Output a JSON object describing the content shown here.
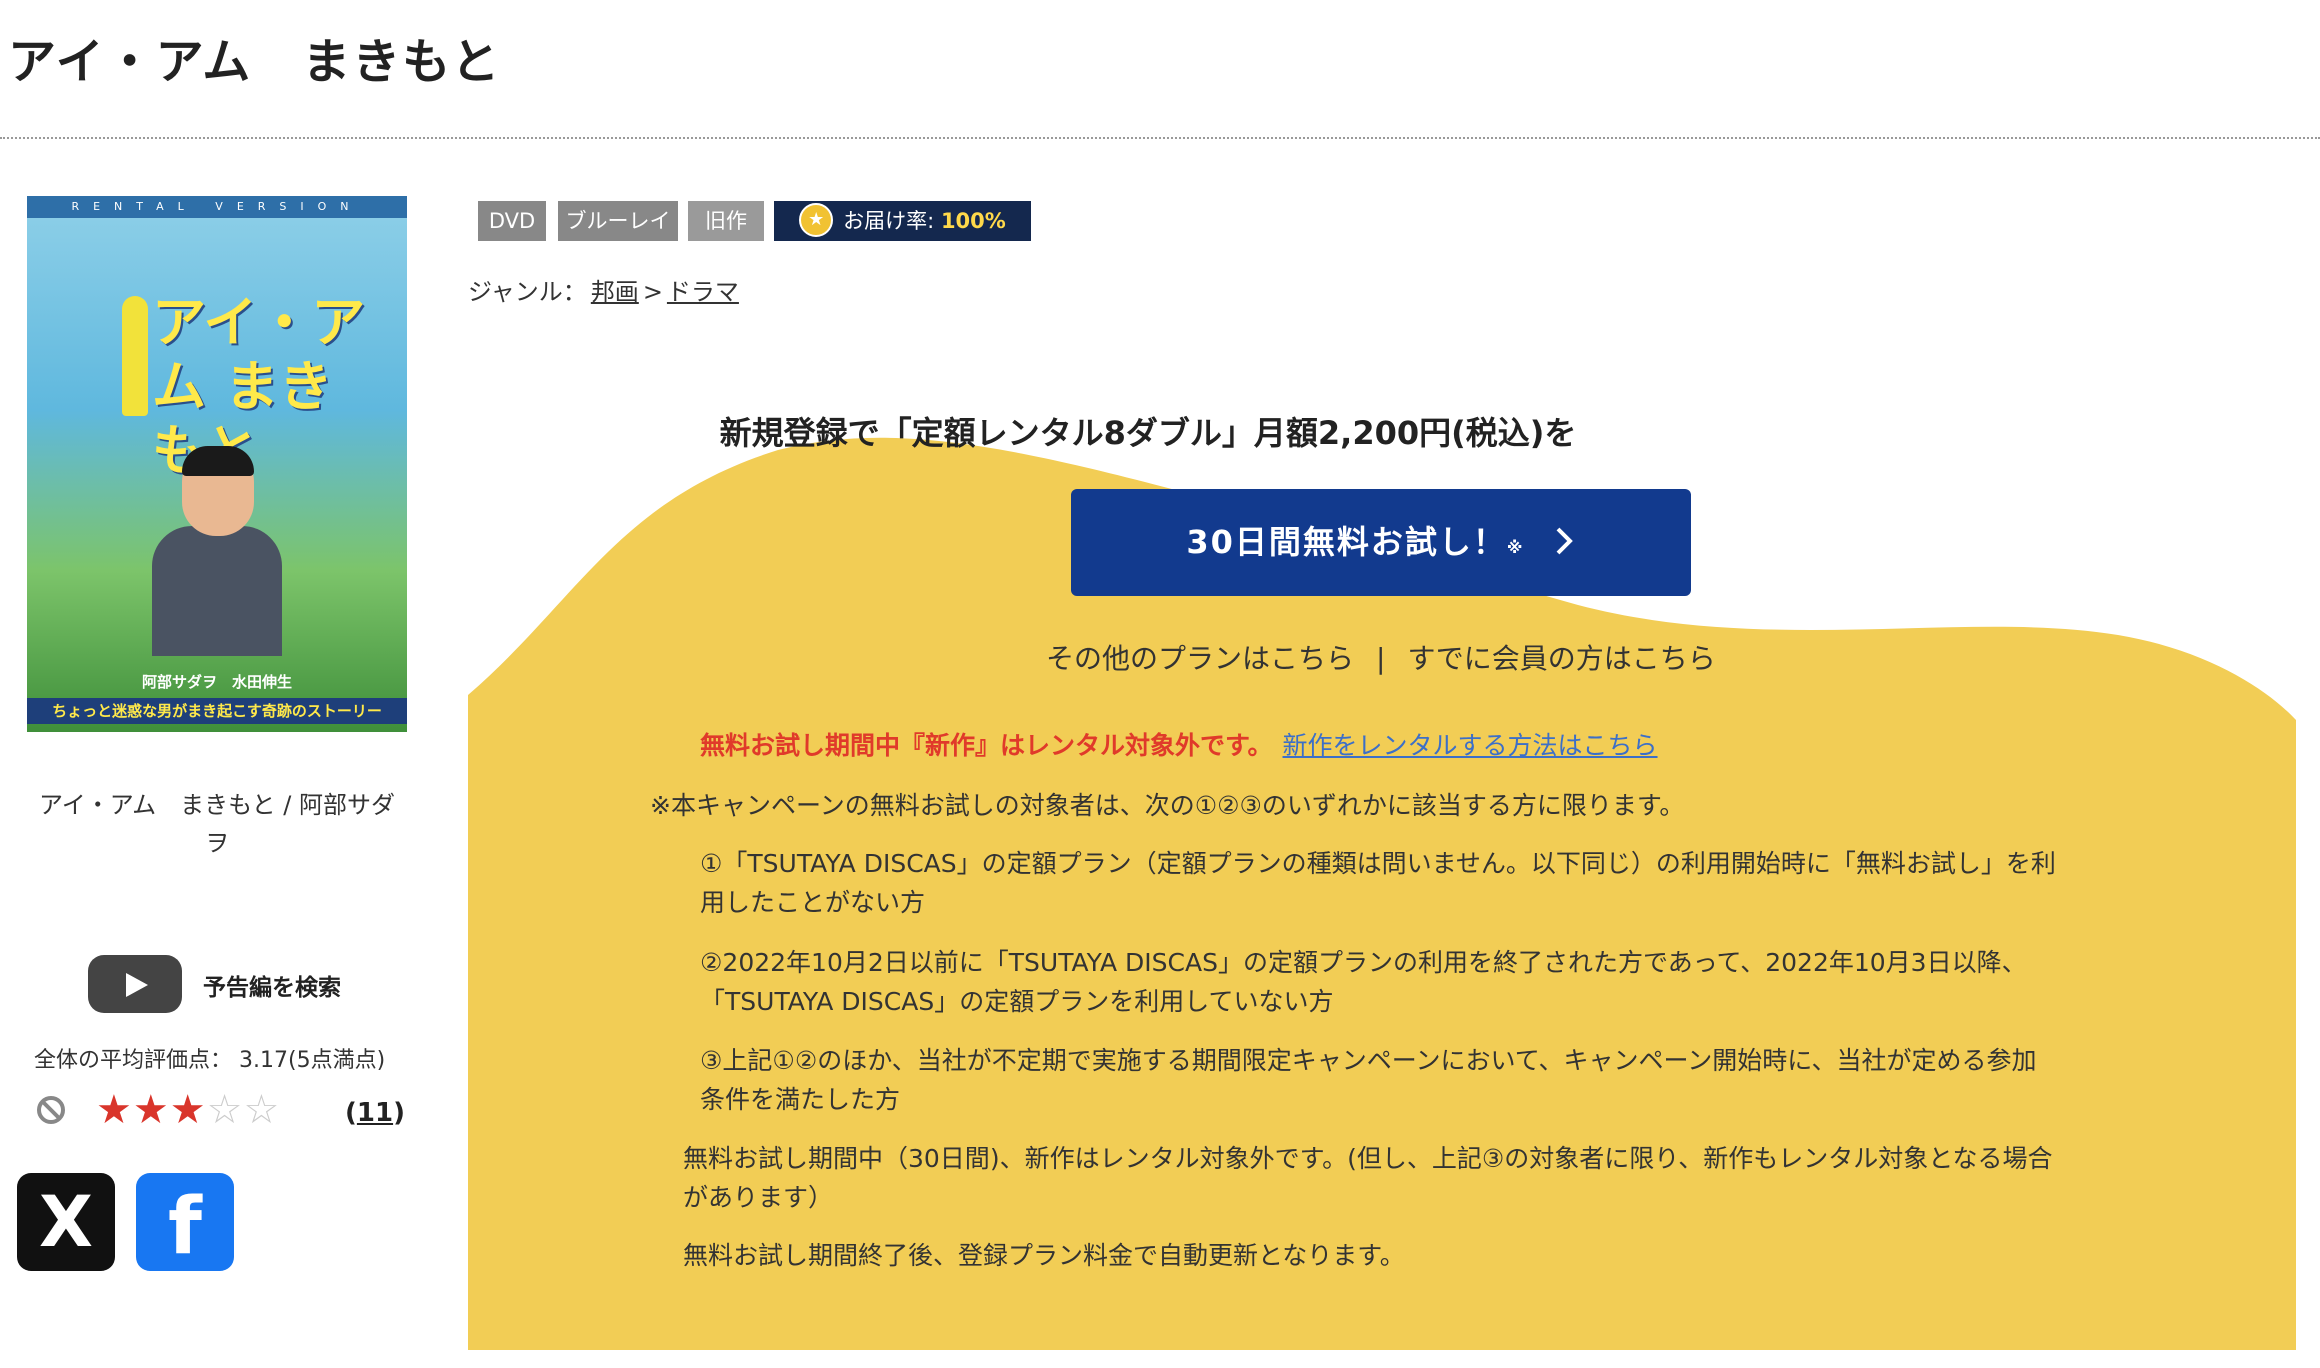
{
  "page": {
    "title": "アイ・アム　まきもと"
  },
  "jacket": {
    "strip": "RENTAL VERSION",
    "title": "アイ・アム まきもと",
    "cast": "阿部サダヲ　水田伸生",
    "tagline": "ちょっと迷惑な男がまき起こす奇跡のストーリー"
  },
  "caption": "アイ・アム　まきもと / 阿部サダヲ",
  "trailer": {
    "label": "予告編を検索"
  },
  "rating": {
    "avg_label": "全体の平均評価点：",
    "avg_value": "3.17(5点満点)",
    "stars_filled": 3,
    "stars_total": 5,
    "count": "11"
  },
  "badges": {
    "dvd": "DVD",
    "bluray": "ブルーレイ",
    "old": "旧作",
    "delivery_label": "お届け率:",
    "delivery_rate": "100%"
  },
  "genre": {
    "label": "ジャンル：",
    "items": [
      "邦画",
      "ドラマ"
    ],
    "sep": ">"
  },
  "promo": {
    "headline": "新規登録で「定額レンタル8ダブル」月額2,200円(税込)を",
    "button_label": "30日間無料お試し！",
    "button_mark": "※",
    "link_other": "その他のプランはこちら",
    "link_member": "すでに会員の方はこちら",
    "link_sep": "|",
    "red_notice": "無料お試し期間中『新作』はレンタル対象外です。",
    "red_link": "新作をレンタルする方法はこちら",
    "note_main": "※本キャンペーンの無料お試しの対象者は、次の①②③のいずれかに該当する方に限ります。",
    "cond1_a": "①「TSUTAYA DISCAS」の定額プラン（定額プランの種類は問いません。以下同じ）の利用開始時に「無料お試し」を利",
    "cond1_b": "用したことがない方",
    "cond2_a": "②2022年10月2日以前に「TSUTAYA DISCAS」の定額プランの利用を終了された方であって、2022年10月3日以降、",
    "cond2_b": "「TSUTAYA DISCAS」の定額プランを利用していない方",
    "cond3_a": "③上記①②のほか、当社が不定期で実施する期間限定キャンペーンにおいて、キャンペーン開始時に、当社が定める参加",
    "cond3_b": "条件を満たした方",
    "note_trial_a": "無料お試し期間中（30日間)、新作はレンタル対象外です。(但し、上記③の対象者に限り、新作もレンタル対象となる場合",
    "note_trial_b": "があります）",
    "note_auto": "無料お試し期間終了後、登録プラン料金で自動更新となります。"
  },
  "colors": {
    "promo_bg": "#f2cd55",
    "button": "#123a8e",
    "red": "#e03a2a",
    "link": "#3c6fc8"
  },
  "icons": {
    "trailer": "play-icon",
    "ban": "ban-icon",
    "x": "x-logo-icon",
    "facebook": "facebook-logo-icon",
    "medal": "star-medal-icon",
    "chevron": "chevron-right-icon"
  }
}
